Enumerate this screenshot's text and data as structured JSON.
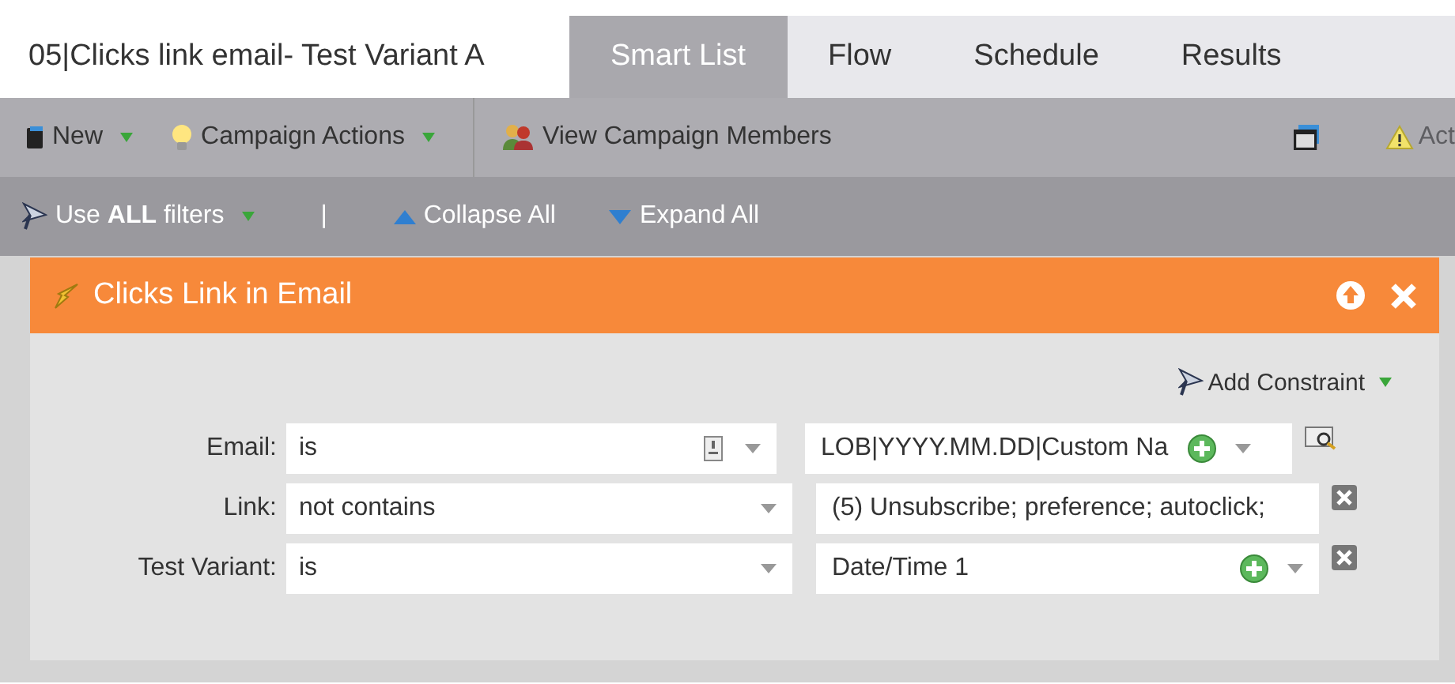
{
  "header": {
    "title": "05|Clicks link email- Test Variant A",
    "tabs": [
      {
        "label": "Smart List",
        "selected": true
      },
      {
        "label": "Flow",
        "selected": false
      },
      {
        "label": "Schedule",
        "selected": false
      },
      {
        "label": "Results",
        "selected": false
      }
    ]
  },
  "toolbar": {
    "items": [
      {
        "kind": "book",
        "label": "New",
        "dropdown": true
      },
      {
        "kind": "bulb",
        "label": "Campaign Actions",
        "dropdown": true
      },
      {
        "kind": "people",
        "label": "View Campaign Members",
        "dropdown": false
      }
    ],
    "right_items": [
      {
        "kind": "window"
      },
      {
        "kind": "warning",
        "label": "Act"
      }
    ]
  },
  "filter_bar": {
    "logic": "Use **ALL** filters",
    "separator": "|",
    "collapse": "Collapse All",
    "expand": "Expand All"
  },
  "filter": {
    "title": "Clicks Link in Email",
    "add_constraint": "Add Constraint",
    "rows": [
      {
        "kind": "asset",
        "label": "Email:",
        "operator": "is",
        "value": "LOB|YYYY.MM.DD|Custom Na"
      },
      {
        "kind": "text",
        "label": "Link:",
        "operator": "not contains",
        "value": "(5) Unsubscribe; preference; autoclick;"
      },
      {
        "kind": "picklist",
        "label": "Test Variant:",
        "operator": "is",
        "value": "Date/Time 1"
      }
    ]
  }
}
